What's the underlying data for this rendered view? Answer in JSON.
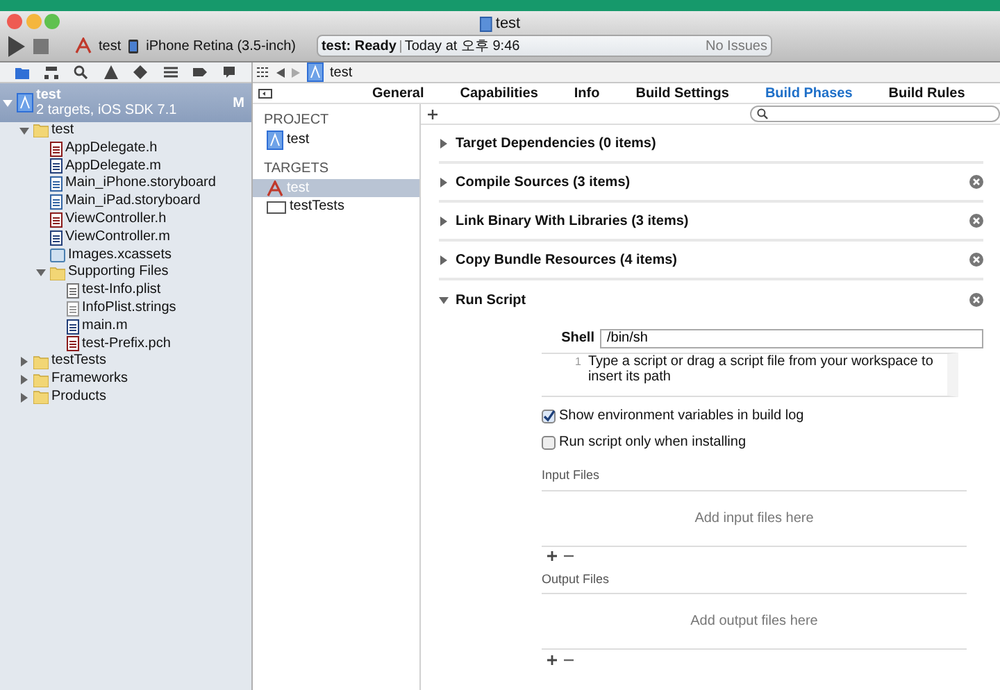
{
  "window": {
    "title": "test"
  },
  "toolbar": {
    "scheme": "test",
    "device": "iPhone Retina (3.5-inch)",
    "status": "test: Ready",
    "time": "Today at 오후 9:46",
    "issues": "No Issues"
  },
  "navigator": {
    "tree": [
      {
        "label": "test",
        "subtitle": "2 targets, iOS SDK 7.1",
        "badge": "M",
        "kind": "project",
        "expanded": true,
        "selected": true,
        "children": [
          {
            "label": "test",
            "kind": "folder",
            "expanded": true,
            "selected": false,
            "children": [
              {
                "label": "AppDelegate.h",
                "kind": "h",
                "selected": false
              },
              {
                "label": "AppDelegate.m",
                "kind": "m",
                "selected": false
              },
              {
                "label": "Main_iPhone.storyboard",
                "kind": "storyboard",
                "selected": false
              },
              {
                "label": "Main_iPad.storyboard",
                "kind": "storyboard",
                "selected": false
              },
              {
                "label": "ViewController.h",
                "kind": "h",
                "selected": false
              },
              {
                "label": "ViewController.m",
                "kind": "m",
                "selected": false
              },
              {
                "label": "Images.xcassets",
                "kind": "xcassets",
                "selected": false
              },
              {
                "label": "Supporting Files",
                "kind": "folder",
                "expanded": true,
                "selected": false,
                "children": [
                  {
                    "label": "test-Info.plist",
                    "kind": "plist",
                    "selected": false
                  },
                  {
                    "label": "InfoPlist.strings",
                    "kind": "strings",
                    "selected": false
                  },
                  {
                    "label": "main.m",
                    "kind": "m",
                    "selected": false
                  },
                  {
                    "label": "test-Prefix.pch",
                    "kind": "h",
                    "selected": false
                  }
                ]
              }
            ]
          },
          {
            "label": "testTests",
            "kind": "folder",
            "expanded": false,
            "selected": false
          },
          {
            "label": "Frameworks",
            "kind": "folder",
            "expanded": false,
            "selected": false
          },
          {
            "label": "Products",
            "kind": "folder",
            "expanded": false,
            "selected": false
          }
        ]
      }
    ]
  },
  "jump_bar": {
    "path": "test"
  },
  "tabs": [
    {
      "label": "General",
      "selected": false
    },
    {
      "label": "Capabilities",
      "selected": false
    },
    {
      "label": "Info",
      "selected": false
    },
    {
      "label": "Build Settings",
      "selected": false
    },
    {
      "label": "Build Phases",
      "selected": true
    },
    {
      "label": "Build Rules",
      "selected": false
    }
  ],
  "targets_list": {
    "project_heading": "PROJECT",
    "projects": [
      {
        "label": "test",
        "selected": false
      }
    ],
    "targets_heading": "TARGETS",
    "targets": [
      {
        "label": "test",
        "kind": "app",
        "selected": true
      },
      {
        "label": "testTests",
        "kind": "bundle",
        "selected": false
      }
    ]
  },
  "phases": [
    {
      "title": "Target Dependencies (0 items)",
      "expanded": false,
      "removable": false
    },
    {
      "title": "Compile Sources (3 items)",
      "expanded": false,
      "removable": true
    },
    {
      "title": "Link Binary With Libraries (3 items)",
      "expanded": false,
      "removable": true
    },
    {
      "title": "Copy Bundle Resources (4 items)",
      "expanded": false,
      "removable": true
    },
    {
      "title": "Run Script",
      "expanded": true,
      "removable": true,
      "details": {
        "shell_label": "Shell",
        "shell": "/bin/sh",
        "line_number": "1",
        "script_placeholder": "Type a script or drag a script file from your workspace to insert its path",
        "options": [
          {
            "label": "Show environment variables in build log",
            "checked": true
          },
          {
            "label": "Run script only when installing",
            "checked": false
          }
        ],
        "file_lists": [
          {
            "heading": "Input Files",
            "placeholder": "Add input files here"
          },
          {
            "heading": "Output Files",
            "placeholder": "Add output files here"
          }
        ]
      }
    }
  ]
}
